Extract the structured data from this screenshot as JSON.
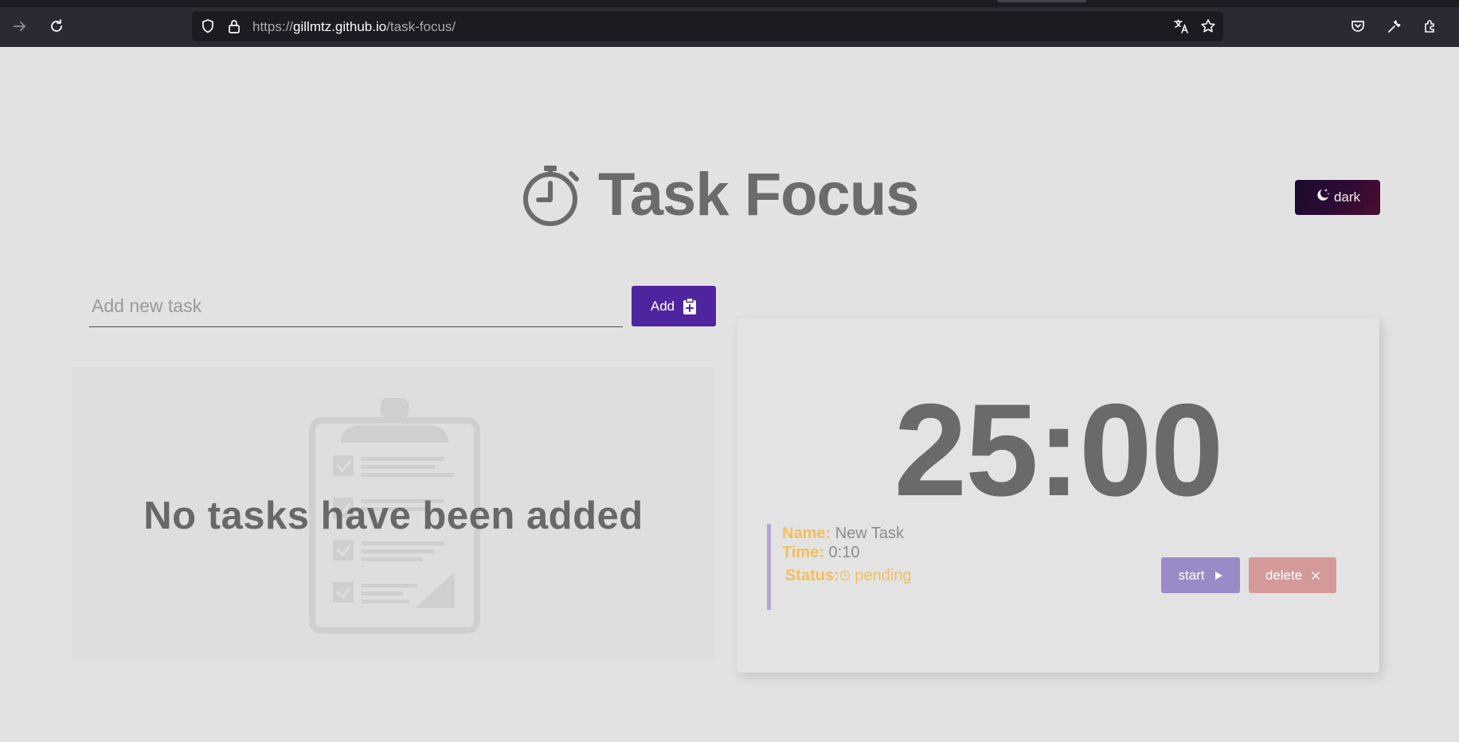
{
  "browser": {
    "url_scheme": "https://",
    "url_domain": "gillmtz.github.io",
    "url_path": "/task-focus/",
    "toolbar_icons": [
      "forward-icon",
      "reload-icon",
      "shield-icon",
      "lock-icon",
      "translate-icon",
      "bookmark-star-icon",
      "pocket-icon",
      "wrench-icon",
      "extensions-icon"
    ]
  },
  "header": {
    "title": "Task Focus",
    "icon": "stopwatch-icon"
  },
  "theme_toggle": {
    "label": "dark",
    "icon": "moon-stars-icon"
  },
  "task_form": {
    "placeholder": "Add new task",
    "value": "",
    "add_label": "Add",
    "add_icon": "clipboard-plus-icon"
  },
  "task_list": {
    "empty_message": "No tasks have been added",
    "illustration": "clipboard-checklist-icon"
  },
  "timer": {
    "display": "25:00",
    "task": {
      "name_key": "Name:",
      "name_value": "New Task",
      "time_key": "Time:",
      "time_value": "0:10",
      "status_key": "Status:",
      "status_value": "pending"
    },
    "start_label": "start",
    "delete_label": "delete"
  },
  "colors": {
    "background": "#e2e2e2",
    "primary": "#4f249f",
    "start": "#9a8bc6",
    "delete": "#d49a9a",
    "accent": "#f2bf5e",
    "text": "#6b6b6b"
  }
}
